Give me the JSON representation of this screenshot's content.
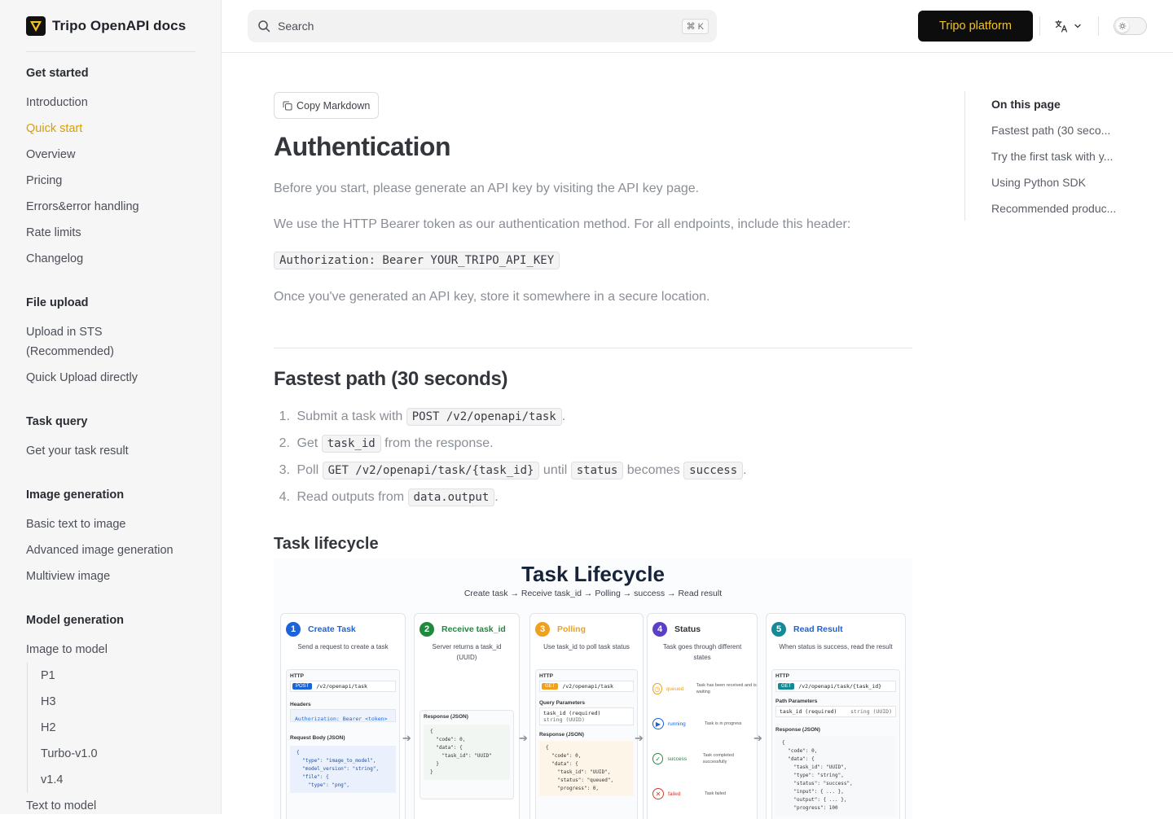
{
  "brand": {
    "title": "Tripo OpenAPI docs"
  },
  "sidebar": {
    "groups": [
      {
        "title": "Get started",
        "items": [
          "Introduction",
          "Quick start",
          "Overview",
          "Pricing",
          "Errors&error handling",
          "Rate limits",
          "Changelog"
        ]
      },
      {
        "title": "File upload",
        "items": [
          "Upload in STS",
          "(Recommended)",
          "Quick Upload directly"
        ]
      },
      {
        "title": "Task query",
        "items": [
          "Get your task result"
        ]
      },
      {
        "title": "Image generation",
        "items": [
          "Basic text to image",
          "Advanced image generation",
          "Multiview image"
        ]
      },
      {
        "title": "Model generation",
        "items": [
          "Image to model",
          "P1",
          "H3",
          "H2",
          "Turbo-v1.0",
          "v1.4",
          "Text to model"
        ]
      }
    ],
    "active_item": "Quick start",
    "active_color": "#d69e0a"
  },
  "topbar": {
    "search_placeholder": "Search",
    "search_shortcut": "⌘ K",
    "cta_label": "Tripo platform",
    "cta_text_color": "#f6c31b",
    "language_icon": "translate-icon",
    "theme_icon": "sun-icon"
  },
  "main": {
    "copy_markdown": "Copy Markdown",
    "title": "Authentication",
    "intro": "Before you start, please generate an API key by visiting the API key page.",
    "auth_method": "We use the HTTP Bearer token as our authentication method. For all endpoints, include this header:",
    "header_code": "Authorization: Bearer YOUR_TRIPO_API_KEY",
    "store_note": "Once you've generated an API key, store it somewhere in a secure location.",
    "fastest_heading": "Fastest path (30 seconds)",
    "steps": {
      "s1_num": "1.",
      "s1_pre": "Submit a task with",
      "s1_code": "POST /v2/openapi/task",
      "s1_post": ".",
      "s2_num": "2.",
      "s2_pre": "Get",
      "s2_code": "task_id",
      "s2_post": "from the response.",
      "s3_num": "3.",
      "s3_pre": "Poll",
      "s3_code": "GET /v2/openapi/task/{task_id}",
      "s3_mid": "until",
      "s3_code2": "status",
      "s3_mid2": "becomes",
      "s3_code3": "success",
      "s3_post": ".",
      "s4_num": "4.",
      "s4_pre": "Read outputs from",
      "s4_code": "data.output",
      "s4_post": "."
    },
    "lifecycle_heading": "Task lifecycle"
  },
  "diagram": {
    "title": "Task Lifecycle",
    "subtitle": "Create task → Receive task_id → Polling → success → Read result",
    "columns": [
      {
        "num": "1",
        "title": "Create Task",
        "color": "#1a63d8",
        "desc": "Send a request to create a task"
      },
      {
        "num": "2",
        "title": "Receive task_id",
        "color": "#1f8a3e",
        "desc": "Server returns a task_id (UUID)"
      },
      {
        "num": "3",
        "title": "Polling",
        "color": "#f0a020",
        "desc": "Use task_id to poll task status"
      },
      {
        "num": "4",
        "title": "Status",
        "color": "#5b3fc4",
        "desc": "Task goes through different states"
      },
      {
        "num": "5",
        "title": "Read Result",
        "color": "#138a96",
        "desc": "When status is success, read the result"
      }
    ],
    "http_label": "HTTP",
    "post": "POST",
    "get": "GET",
    "path_task": "/v2/openapi/task",
    "path_task_id": "/v2/openapi/task/{task_id}",
    "headers_label": "Headers",
    "auth_header": "Authorization: Bearer <token>",
    "request_body_label": "Request Body (JSON)",
    "request_body": "{\n  \"type\": \"image_to_model\",\n  \"model_version\": \"string\",\n  \"file\": {\n    \"type\": \"png\",",
    "response_label": "Response (JSON)",
    "response_task_id": "{\n  \"code\": 0,\n  \"data\": {\n    \"task_id\": \"UUID\"\n  }\n}",
    "query_params_label": "Query Parameters",
    "query_param": "task_id  (required)",
    "query_param_type": "string (UUID)",
    "response_poll": "{\n  \"code\": 0,\n  \"data\": {\n    \"task_id\": \"UUID\",\n    \"status\": \"queued\",\n    \"progress\": 0,",
    "path_params_label": "Path Parameters",
    "path_param": "task_id  (required)",
    "path_param_type": "string (UUID)",
    "response_result": "{\n  \"code\": 0,\n  \"data\": {\n    \"task_id\": \"UUID\",\n    \"type\": \"string\",\n    \"status\": \"success\",\n    \"input\": { ... },\n    \"output\": { ... },\n    \"progress\": 100",
    "states": [
      {
        "name": "queued",
        "note": "Task has been received and is waiting",
        "color": "#f0a020",
        "icon": "clock-icon"
      },
      {
        "name": "running",
        "note": "Task is in progress",
        "color": "#1a63d8",
        "icon": "play-icon"
      },
      {
        "name": "success",
        "note": "Task completed successfully",
        "color": "#1f8a3e",
        "icon": "check-icon"
      },
      {
        "name": "failed",
        "note": "Task failed",
        "color": "#d23b2f",
        "icon": "x-icon"
      }
    ]
  },
  "toc": {
    "title": "On this page",
    "items": [
      "Fastest path (30 seco...",
      "Try the first task with y...",
      "Using Python SDK",
      "Recommended produc..."
    ]
  }
}
